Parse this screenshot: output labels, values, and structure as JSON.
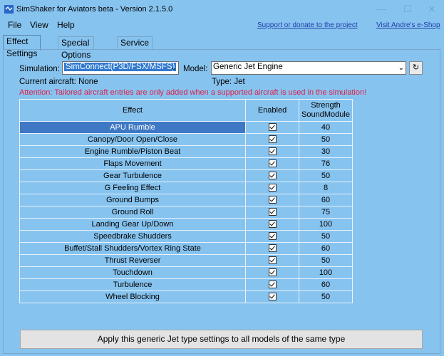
{
  "window": {
    "title": "SimShaker for Aviators beta  - Version 2.1.5.0"
  },
  "menu": {
    "items": [
      "File",
      "View",
      "Help"
    ],
    "support_link": "Support or donate to the project",
    "eshop_link": "Visit Andre's e-Shop"
  },
  "tabs": [
    "Effect Settings",
    "Special Options",
    "Service"
  ],
  "effect_settings": {
    "simulation_label": "Simulation:",
    "simulation_value": "SimConnect(P3D/FSX/MSFS)",
    "model_label": "Model:",
    "model_value": "Generic Jet Engine",
    "current_aircraft": "Current aircraft: None",
    "type": "Type: Jet",
    "attention": "Attention: Tailored aircraft entries are only added when a supported aircraft is used in the simulation!",
    "columns": [
      "Effect",
      "Enabled",
      "Strength\nSoundModule"
    ],
    "rows": [
      {
        "effect": "APU Rumble",
        "enabled": true,
        "strength": "40"
      },
      {
        "effect": "Canopy/Door Open/Close",
        "enabled": true,
        "strength": "50"
      },
      {
        "effect": "Engine Rumble/Piston Beat",
        "enabled": true,
        "strength": "30"
      },
      {
        "effect": "Flaps Movement",
        "enabled": true,
        "strength": "76"
      },
      {
        "effect": "Gear Turbulence",
        "enabled": true,
        "strength": "50"
      },
      {
        "effect": "G Feeling Effect",
        "enabled": true,
        "strength": "8"
      },
      {
        "effect": "Ground Bumps",
        "enabled": true,
        "strength": "60"
      },
      {
        "effect": "Ground Roll",
        "enabled": true,
        "strength": "75"
      },
      {
        "effect": "Landing Gear Up/Down",
        "enabled": true,
        "strength": "100"
      },
      {
        "effect": "Speedbrake Shudders",
        "enabled": true,
        "strength": "50"
      },
      {
        "effect": "Buffet/Stall Shudders/Vortex Ring State",
        "enabled": true,
        "strength": "60"
      },
      {
        "effect": "Thrust Reverser",
        "enabled": true,
        "strength": "50"
      },
      {
        "effect": "Touchdown",
        "enabled": true,
        "strength": "100"
      },
      {
        "effect": "Turbulence",
        "enabled": true,
        "strength": "60"
      },
      {
        "effect": "Wheel Blocking",
        "enabled": true,
        "strength": "50"
      }
    ],
    "apply_button": "Apply this generic Jet type settings to all models of the same type"
  },
  "icons": {
    "refresh": "refresh-icon",
    "checkbox": "check-icon",
    "app": "app-icon"
  }
}
